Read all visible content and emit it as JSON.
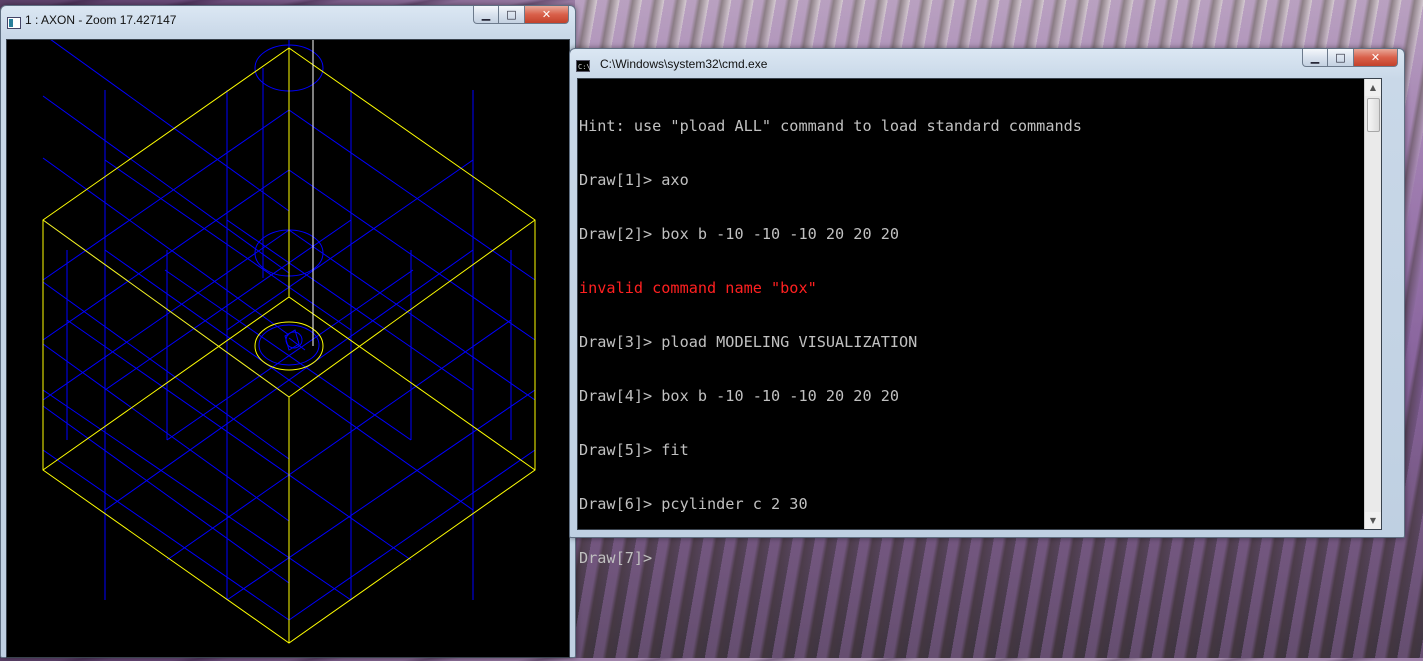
{
  "desktop": {
    "background": "lavender-field"
  },
  "axon_window": {
    "title": "1 : AXON - Zoom 17.427147",
    "minimize_glyph": "▁",
    "maximize_glyph": "□",
    "close_glyph": "✕",
    "colors": {
      "canvas": "#000000",
      "box_edges": "#ffff00",
      "grid": "#0000ff"
    }
  },
  "cmd_window": {
    "title": "C:\\Windows\\system32\\cmd.exe",
    "minimize_glyph": "▁",
    "maximize_glyph": "□",
    "close_glyph": "✕",
    "colors": {
      "background": "#000000",
      "text": "#c0c0c0",
      "error": "#ff2020"
    },
    "lines": [
      {
        "text": "Hint: use \"pload ALL\" command to load standard commands",
        "error": false
      },
      {
        "text": "Draw[1]> axo",
        "error": false
      },
      {
        "text": "Draw[2]> box b -10 -10 -10 20 20 20",
        "error": false
      },
      {
        "text": "invalid command name \"box\"",
        "error": true
      },
      {
        "text": "Draw[3]> pload MODELING VISUALIZATION",
        "error": false
      },
      {
        "text": "Draw[4]> box b -10 -10 -10 20 20 20",
        "error": false
      },
      {
        "text": "Draw[5]> fit",
        "error": false
      },
      {
        "text": "Draw[6]> pcylinder c 2 30",
        "error": false
      },
      {
        "text": "Draw[7]>",
        "error": false
      }
    ],
    "scroll_up_glyph": "▲",
    "scroll_down_glyph": "▼"
  }
}
